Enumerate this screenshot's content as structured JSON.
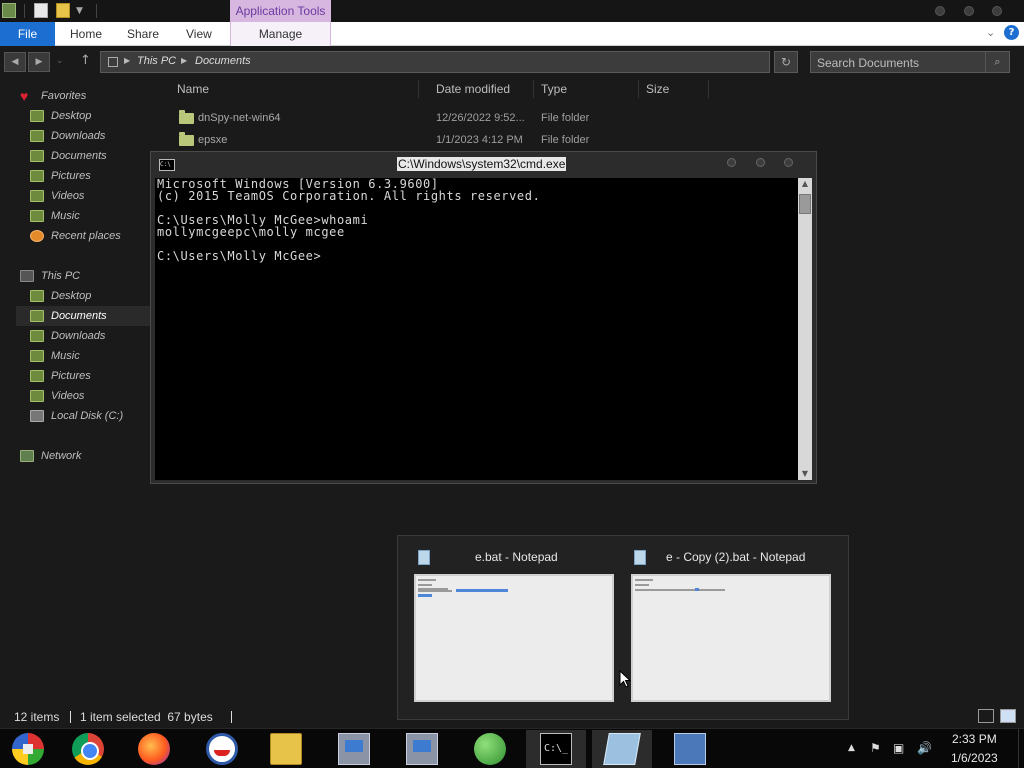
{
  "ribbon": {
    "contextual_title": "Application Tools",
    "tabs": [
      "File",
      "Home",
      "Share",
      "View",
      "Manage"
    ]
  },
  "address": {
    "crumbs": [
      "This PC",
      "Documents"
    ],
    "search_placeholder": "Search Documents"
  },
  "navigation": {
    "favorites_label": "Favorites",
    "favorites": [
      "Desktop",
      "Downloads",
      "Documents",
      "Pictures",
      "Videos",
      "Music",
      "Recent places"
    ],
    "thispc_label": "This PC",
    "thispc": [
      "Desktop",
      "Documents",
      "Downloads",
      "Music",
      "Pictures",
      "Videos",
      "Local Disk (C:)"
    ],
    "network_label": "Network",
    "selected": "Documents"
  },
  "filelist": {
    "columns": [
      "Name",
      "Date modified",
      "Type",
      "Size"
    ],
    "rows": [
      {
        "name": "dnSpy-net-win64",
        "date": "12/26/2022 9:52...",
        "type": "File folder"
      },
      {
        "name": "epsxe",
        "date": "1/1/2023 4:12 PM",
        "type": "File folder"
      }
    ]
  },
  "status": {
    "items": "12 items",
    "selected": "1 item selected  67 bytes"
  },
  "cmd": {
    "title": "C:\\Windows\\system32\\cmd.exe",
    "lines": [
      "Microsoft Windows [Version 6.3.9600]",
      "(c) 2015 TeamOS Corporation. All rights reserved.",
      "",
      "C:\\Users\\Molly McGee>whoami",
      "mollymcgeepc\\molly mcgee",
      "",
      "C:\\Users\\Molly McGee>"
    ]
  },
  "thumbnails": [
    {
      "title": "e.bat - Notepad"
    },
    {
      "title": "e - Copy (2).bat - Notepad"
    }
  ],
  "taskbar": {
    "apps": [
      "start",
      "chrome",
      "firefox",
      "obama",
      "explorer",
      "installer-1",
      "installer-2",
      "people",
      "cmd",
      "notepad",
      "remote-desktop"
    ],
    "clock_time": "2:33 PM",
    "clock_date": "1/6/2023"
  },
  "colors": {
    "file_tab": "#1c6fd1",
    "contextual_tab": "#d7b7e0",
    "background": "#1a1a1a"
  }
}
